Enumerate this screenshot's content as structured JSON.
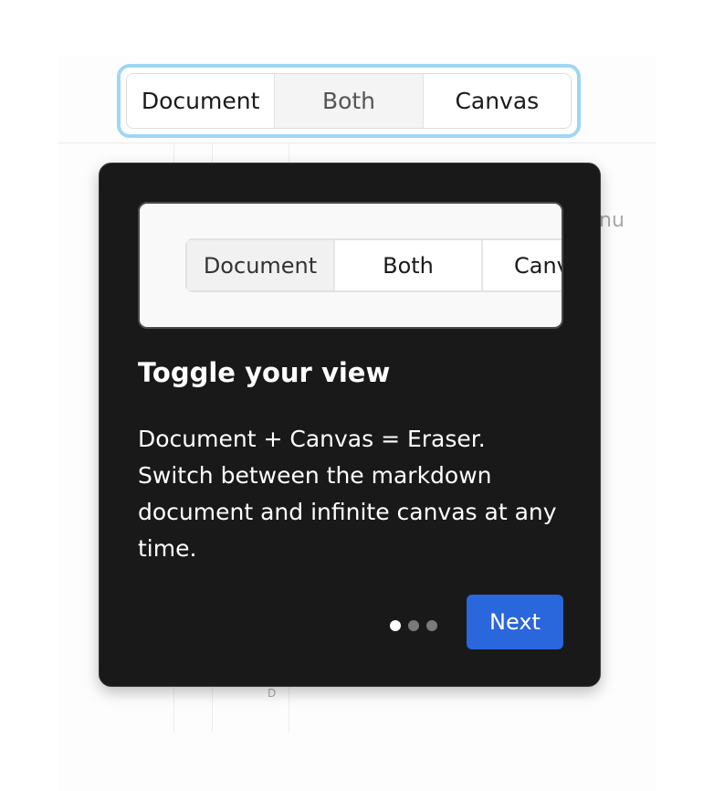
{
  "view_toggle": {
    "options": [
      "Document",
      "Both",
      "Canvas"
    ],
    "selected": "Both"
  },
  "background": {
    "menu_fragment": "nu",
    "small_label": "D"
  },
  "tooltip": {
    "preview_options": [
      "Document",
      "Both",
      "Canv"
    ],
    "title": "Toggle your view",
    "body": "Document + Canvas = Eraser. Switch between the markdown document and infinite canvas at any time.",
    "step_current": 1,
    "step_total": 3,
    "next_label": "Next"
  },
  "colors": {
    "focus_ring": "#9fd6f4",
    "tooltip_bg": "#191919",
    "next_button": "#2a66dc"
  }
}
